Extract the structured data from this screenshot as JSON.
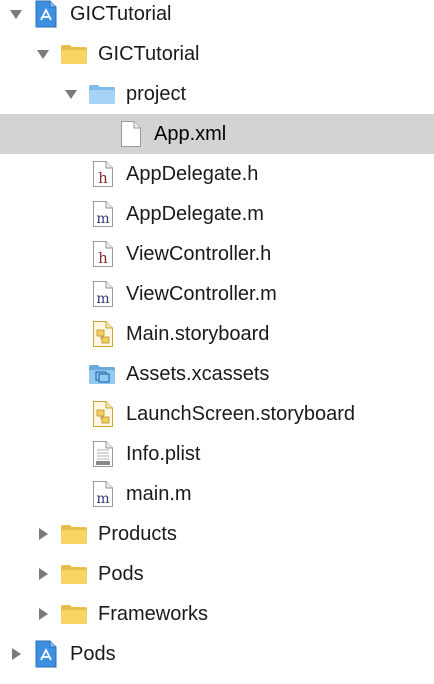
{
  "navigator": {
    "items": [
      {
        "label": "GICTutorial",
        "kind": "project",
        "disclosure": "expanded"
      },
      {
        "label": "GICTutorial",
        "kind": "folder",
        "disclosure": "expanded"
      },
      {
        "label": "project",
        "kind": "folder-blue",
        "disclosure": "expanded"
      },
      {
        "label": "App.xml",
        "kind": "file-plain",
        "disclosure": "none",
        "selected": true
      },
      {
        "label": "AppDelegate.h",
        "kind": "file-h",
        "disclosure": "none"
      },
      {
        "label": "AppDelegate.m",
        "kind": "file-m",
        "disclosure": "none"
      },
      {
        "label": "ViewController.h",
        "kind": "file-h",
        "disclosure": "none"
      },
      {
        "label": "ViewController.m",
        "kind": "file-m",
        "disclosure": "none"
      },
      {
        "label": "Main.storyboard",
        "kind": "file-storyboard",
        "disclosure": "none"
      },
      {
        "label": "Assets.xcassets",
        "kind": "folder-assets",
        "disclosure": "none"
      },
      {
        "label": "LaunchScreen.storyboard",
        "kind": "file-storyboard",
        "disclosure": "none"
      },
      {
        "label": "Info.plist",
        "kind": "file-plist",
        "disclosure": "none"
      },
      {
        "label": "main.m",
        "kind": "file-m",
        "disclosure": "none"
      },
      {
        "label": "Products",
        "kind": "folder",
        "disclosure": "collapsed"
      },
      {
        "label": "Pods",
        "kind": "folder",
        "disclosure": "collapsed"
      },
      {
        "label": "Frameworks",
        "kind": "folder",
        "disclosure": "collapsed"
      },
      {
        "label": "Pods",
        "kind": "project",
        "disclosure": "collapsed"
      }
    ]
  }
}
